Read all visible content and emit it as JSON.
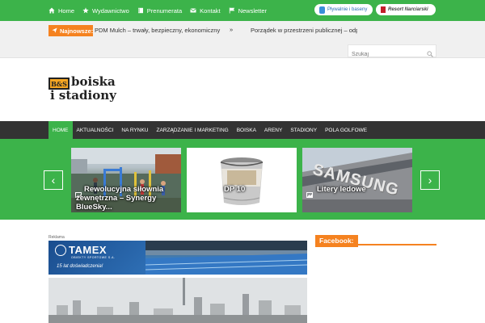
{
  "top_nav": {
    "items": [
      {
        "label": "Home",
        "icon": "home-icon"
      },
      {
        "label": "Wydawnictwo",
        "icon": "star-icon"
      },
      {
        "label": "Prenumerata",
        "icon": "book-icon"
      },
      {
        "label": "Kontakt",
        "icon": "envelope-icon"
      },
      {
        "label": "Newsletter",
        "icon": "flag-icon"
      }
    ],
    "partner1": "Pływalnie i baseny",
    "partner2": "Resort Narciarski"
  },
  "ticker": {
    "label": "Najnowsze:",
    "item1": "PDM Mulch – trwały, bezpieczny, ekonomiczny",
    "separator": "»",
    "item2": "Porządek w przestrzeni publicznej – odpo"
  },
  "search": {
    "placeholder": "Szukaj"
  },
  "logo": {
    "badge": "B&S",
    "line1": "boiska",
    "line2": "i stadiony"
  },
  "main_nav": {
    "items": [
      "HOME",
      "AKTUALNOŚCI",
      "NA RYNKU",
      "ZARZĄDZANIE I MARKETING",
      "BOISKA",
      "ARENY",
      "STADIONY",
      "POLA GOLFOWE"
    ]
  },
  "slider": {
    "prev": "‹",
    "next": "›",
    "slides": [
      {
        "caption_line1": "Rewolucyjna siłownia",
        "caption_line2": "zewnętrzna – Synergy",
        "caption_line3": "BlueSky..."
      },
      {
        "caption_line1": "DP 10"
      },
      {
        "caption_line1": "Litery ledowe",
        "sign": "SAMSUNG"
      }
    ]
  },
  "ad": {
    "label": "Reklama",
    "brand": "TAMEX",
    "brand_sub": "OBIEKTY SPORTOWE S.A.",
    "tagline": "15 lat doświadczenia!"
  },
  "sidebar": {
    "facebook_title": "Facebook:"
  },
  "colors": {
    "green": "#3cb34a",
    "orange": "#f58220",
    "dark_nav": "#333333"
  }
}
